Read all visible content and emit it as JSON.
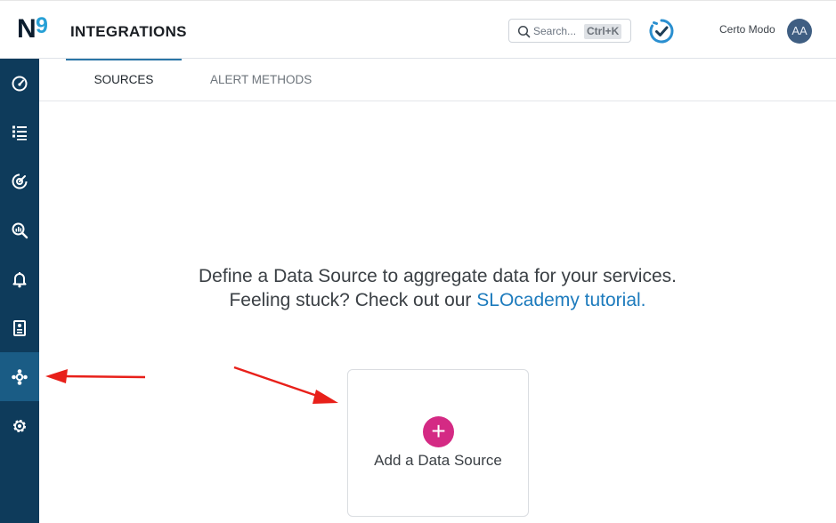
{
  "header": {
    "logo_text": "N9",
    "title": "INTEGRATIONS",
    "search": {
      "placeholder": "Search...",
      "shortcut": "Ctrl+K"
    },
    "user": {
      "name": "Certo Modo",
      "initials": "AA"
    }
  },
  "sidebar": {
    "items": [
      {
        "icon": "speedometer-icon"
      },
      {
        "icon": "list-icon"
      },
      {
        "icon": "target-icon"
      },
      {
        "icon": "search-chart-icon"
      },
      {
        "icon": "bell-icon"
      },
      {
        "icon": "report-icon"
      },
      {
        "icon": "integrations-icon",
        "active": true
      },
      {
        "icon": "gear-icon"
      }
    ]
  },
  "tabs": [
    {
      "label": "SOURCES",
      "active": true
    },
    {
      "label": "ALERT METHODS",
      "active": false
    }
  ],
  "main": {
    "line1": "Define a Data Source to aggregate data for your services.",
    "line2_prefix": "Feeling stuck? Check out our ",
    "line2_link": "SLOcademy tutorial.",
    "add_card": {
      "icon": "+",
      "label": "Add a Data Source"
    }
  },
  "colors": {
    "sidebar": "#0e3b5b",
    "sidebar_active": "#1a5c85",
    "accent_link": "#1d7bbd",
    "add_button": "#d42a84",
    "annotation_arrow": "#e8201a"
  }
}
